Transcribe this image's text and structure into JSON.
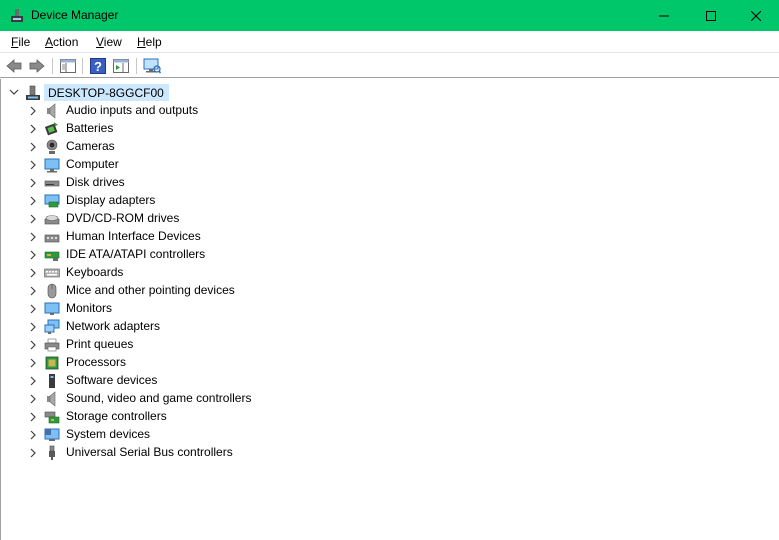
{
  "window": {
    "title": "Device Manager"
  },
  "window_controls": {
    "minimize": "—",
    "maximize": "☐",
    "close": "✕"
  },
  "menu": [
    {
      "label_u": "F",
      "label_rest": "ile"
    },
    {
      "label_u": "A",
      "label_rest": "ction"
    },
    {
      "label_u": "V",
      "label_rest": "iew"
    },
    {
      "label_u": "H",
      "label_rest": "elp"
    }
  ],
  "tree": {
    "root": "DESKTOP-8GGCF00",
    "items": [
      {
        "label": "Audio inputs and outputs",
        "icon": "speaker-icon"
      },
      {
        "label": "Batteries",
        "icon": "battery-icon"
      },
      {
        "label": "Cameras",
        "icon": "camera-icon"
      },
      {
        "label": "Computer",
        "icon": "computer-icon"
      },
      {
        "label": "Disk drives",
        "icon": "disk-drive-icon"
      },
      {
        "label": "Display adapters",
        "icon": "display-adapter-icon"
      },
      {
        "label": "DVD/CD-ROM drives",
        "icon": "dvd-drive-icon"
      },
      {
        "label": "Human Interface Devices",
        "icon": "hid-icon"
      },
      {
        "label": "IDE ATA/ATAPI controllers",
        "icon": "ide-controller-icon"
      },
      {
        "label": "Keyboards",
        "icon": "keyboard-icon"
      },
      {
        "label": "Mice and other pointing devices",
        "icon": "mouse-icon"
      },
      {
        "label": "Monitors",
        "icon": "monitor-icon"
      },
      {
        "label": "Network adapters",
        "icon": "network-adapter-icon"
      },
      {
        "label": "Print queues",
        "icon": "printer-icon"
      },
      {
        "label": "Processors",
        "icon": "processor-icon"
      },
      {
        "label": "Software devices",
        "icon": "software-device-icon"
      },
      {
        "label": "Sound, video and game controllers",
        "icon": "sound-controller-icon"
      },
      {
        "label": "Storage controllers",
        "icon": "storage-controller-icon"
      },
      {
        "label": "System devices",
        "icon": "system-device-icon"
      },
      {
        "label": "Universal Serial Bus controllers",
        "icon": "usb-icon"
      }
    ]
  },
  "colors": {
    "titlebar": "#00c86a",
    "selection": "#cce8ff"
  }
}
